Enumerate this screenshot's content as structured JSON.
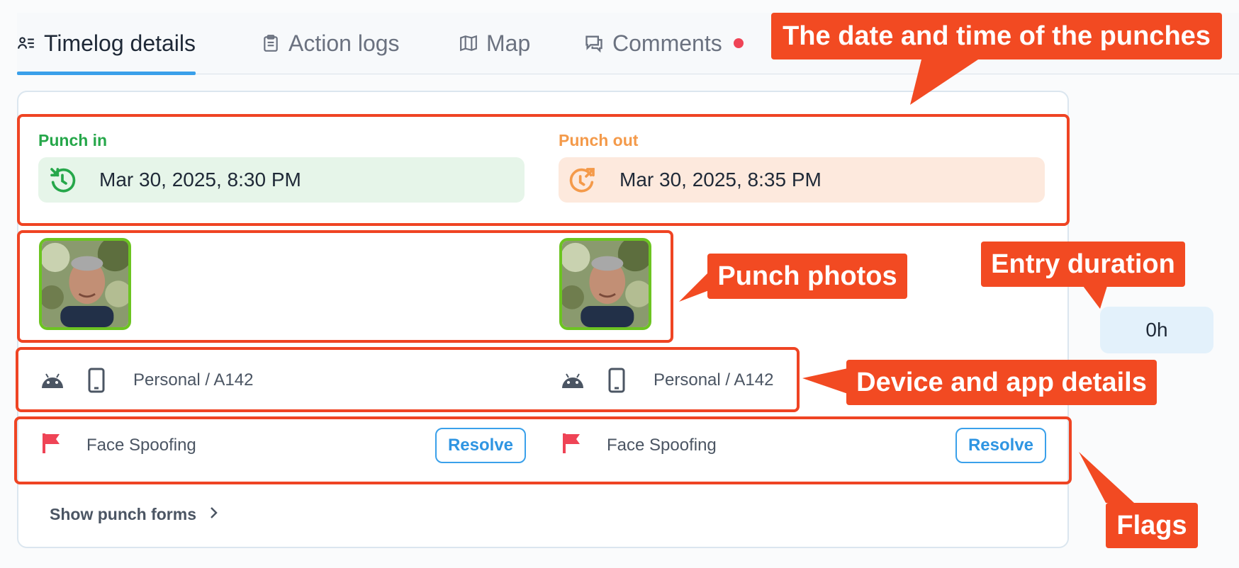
{
  "tabs": [
    {
      "label": "Timelog details",
      "icon": "user-list-icon",
      "active": true
    },
    {
      "label": "Action logs",
      "icon": "clipboard-icon",
      "active": false
    },
    {
      "label": "Map",
      "icon": "map-icon",
      "active": false
    },
    {
      "label": "Comments",
      "icon": "comment-icon",
      "active": false,
      "has_unread": true
    }
  ],
  "punch_in": {
    "label": "Punch in",
    "datetime": "Mar 30, 2025, 8:30 PM",
    "icon": "clock-in-icon",
    "device_os_icon": "android-icon",
    "device_type_icon": "phone-icon",
    "device": "Personal / A142",
    "flag": "Face Spoofing",
    "resolve_label": "Resolve"
  },
  "punch_out": {
    "label": "Punch out",
    "datetime": "Mar 30, 2025, 8:35 PM",
    "icon": "clock-out-icon",
    "device_os_icon": "android-icon",
    "device_type_icon": "phone-icon",
    "device": "Personal / A142",
    "flag": "Face Spoofing",
    "resolve_label": "Resolve"
  },
  "show_forms_label": "Show punch forms",
  "duration": "0h",
  "annotations": {
    "datetime": "The date and time of the punches",
    "photos": "Punch photos",
    "duration": "Entry duration",
    "device": "Device and app details",
    "flags": "Flags"
  },
  "colors": {
    "accent": "#3aa0ea",
    "punch_in": "#26a74a",
    "punch_out": "#f49a4a",
    "flag": "#ef4456",
    "annotation": "#f24a22"
  }
}
